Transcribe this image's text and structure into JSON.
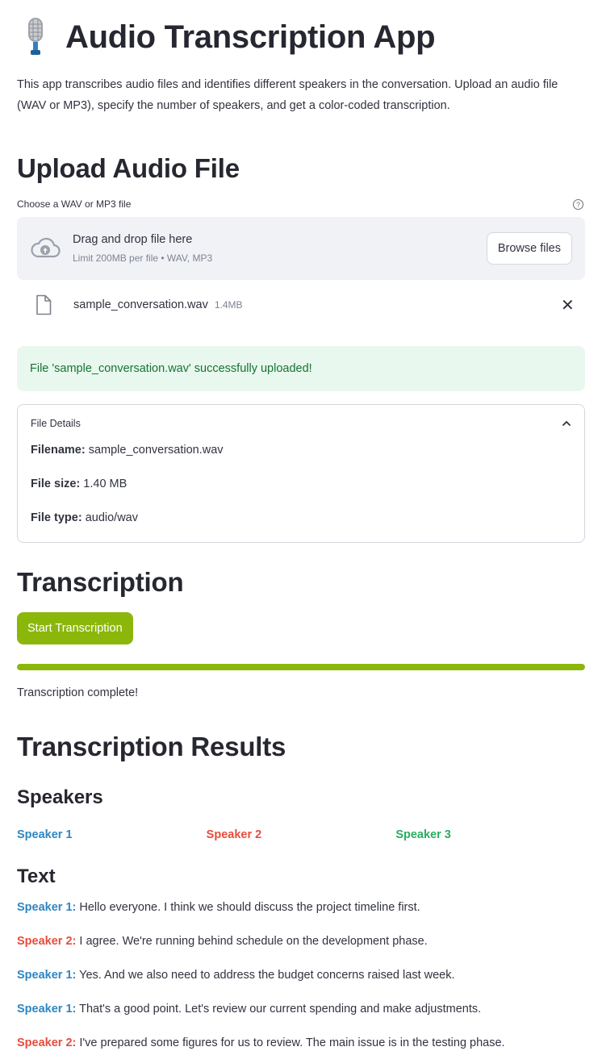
{
  "app": {
    "title": "Audio Transcription App",
    "intro": "This app transcribes audio files and identifies different speakers in the conversation. Upload an audio file (WAV or MP3), specify the number of speakers, and get a color-coded transcription."
  },
  "upload": {
    "heading": "Upload Audio File",
    "label": "Choose a WAV or MP3 file",
    "drop_text": "Drag and drop file here",
    "limit_text": "Limit 200MB per file • WAV, MP3",
    "browse_label": "Browse files",
    "file_name": "sample_conversation.wav",
    "file_size": "1.4MB",
    "success_message": "File 'sample_conversation.wav' successfully uploaded!"
  },
  "details": {
    "title": "File Details",
    "filename_label": "Filename:",
    "filename_value": "sample_conversation.wav",
    "size_label": "File size:",
    "size_value": "1.40 MB",
    "type_label": "File type:",
    "type_value": "audio/wav"
  },
  "transcription": {
    "heading": "Transcription",
    "start_label": "Start Transcription",
    "progress": 1.0,
    "status": "Transcription complete!"
  },
  "results": {
    "heading": "Transcription Results",
    "speakers_heading": "Speakers",
    "speakers": [
      {
        "name": "Speaker 1",
        "color": "#2e86c1"
      },
      {
        "name": "Speaker 2",
        "color": "#e74c3c"
      },
      {
        "name": "Speaker 3",
        "color": "#27ae60"
      }
    ],
    "text_heading": "Text",
    "lines": [
      {
        "speaker": "Speaker 1:",
        "color": "#2e86c1",
        "text": " Hello everyone. I think we should discuss the project timeline first."
      },
      {
        "speaker": "Speaker 2:",
        "color": "#e74c3c",
        "text": " I agree. We're running behind schedule on the development phase."
      },
      {
        "speaker": "Speaker 1:",
        "color": "#2e86c1",
        "text": " Yes. And we also need to address the budget concerns raised last week."
      },
      {
        "speaker": "Speaker 1:",
        "color": "#2e86c1",
        "text": " That's a good point. Let's review our current spending and make adjustments."
      },
      {
        "speaker": "Speaker 2:",
        "color": "#e74c3c",
        "text": " I've prepared some figures for us to review. The main issue is in the testing phase."
      }
    ]
  },
  "colors": {
    "accent": "#8bb70b",
    "success_bg": "#e8f8ee",
    "success_text": "#177233"
  },
  "icons": {
    "title": "microphone-icon",
    "upload": "cloud-upload-icon",
    "file": "file-icon",
    "remove": "close-icon",
    "help": "help-icon",
    "expander": "chevron-up-icon"
  }
}
